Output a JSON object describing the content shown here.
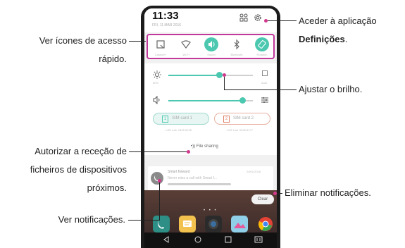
{
  "phone": {
    "time": "11:33",
    "date": "FRI, 11 MAR 2016",
    "quick_access": [
      {
        "label": "Capture+",
        "icon": "capture-icon",
        "on": false
      },
      {
        "label": "Wi-Fi",
        "icon": "wifi-icon",
        "on": false
      },
      {
        "label": "Sound",
        "icon": "sound-icon",
        "on": true
      },
      {
        "label": "Bluetooth",
        "icon": "bluetooth-icon",
        "on": false
      },
      {
        "label": "Rotation",
        "icon": "rotation-icon",
        "on": true
      }
    ],
    "brightness": {
      "percent_label": "60%",
      "auto_label": "Auto",
      "level": 0.6
    },
    "volume": {
      "level": 0.88
    },
    "sim1": {
      "badge": "1",
      "label": "SIM card 1",
      "sub": "LGE Lab. 0405 6195"
    },
    "sim2": {
      "badge": "2",
      "label": "SIM card 2",
      "sub": "LGE Lab. 0405 6177"
    },
    "file_sharing": "File sharing",
    "notification": {
      "title": "Smart forward",
      "time": "20/01/2016",
      "body": "Never miss a call with Smart f..."
    },
    "clear_label": "Clear"
  },
  "callouts": {
    "quick_access": [
      "Ver ícones de acesso",
      "rápido."
    ],
    "settings_line1": "Aceder à aplicação",
    "settings_bold": "Definições",
    "settings_end": ".",
    "brightness": "Ajustar o brilho.",
    "file_sharing": [
      "Autorizar a receção de",
      "ficheiros de dispositivos",
      "próximos."
    ],
    "clear": "Eliminar notificações.",
    "notifications": "Ver notificações."
  }
}
